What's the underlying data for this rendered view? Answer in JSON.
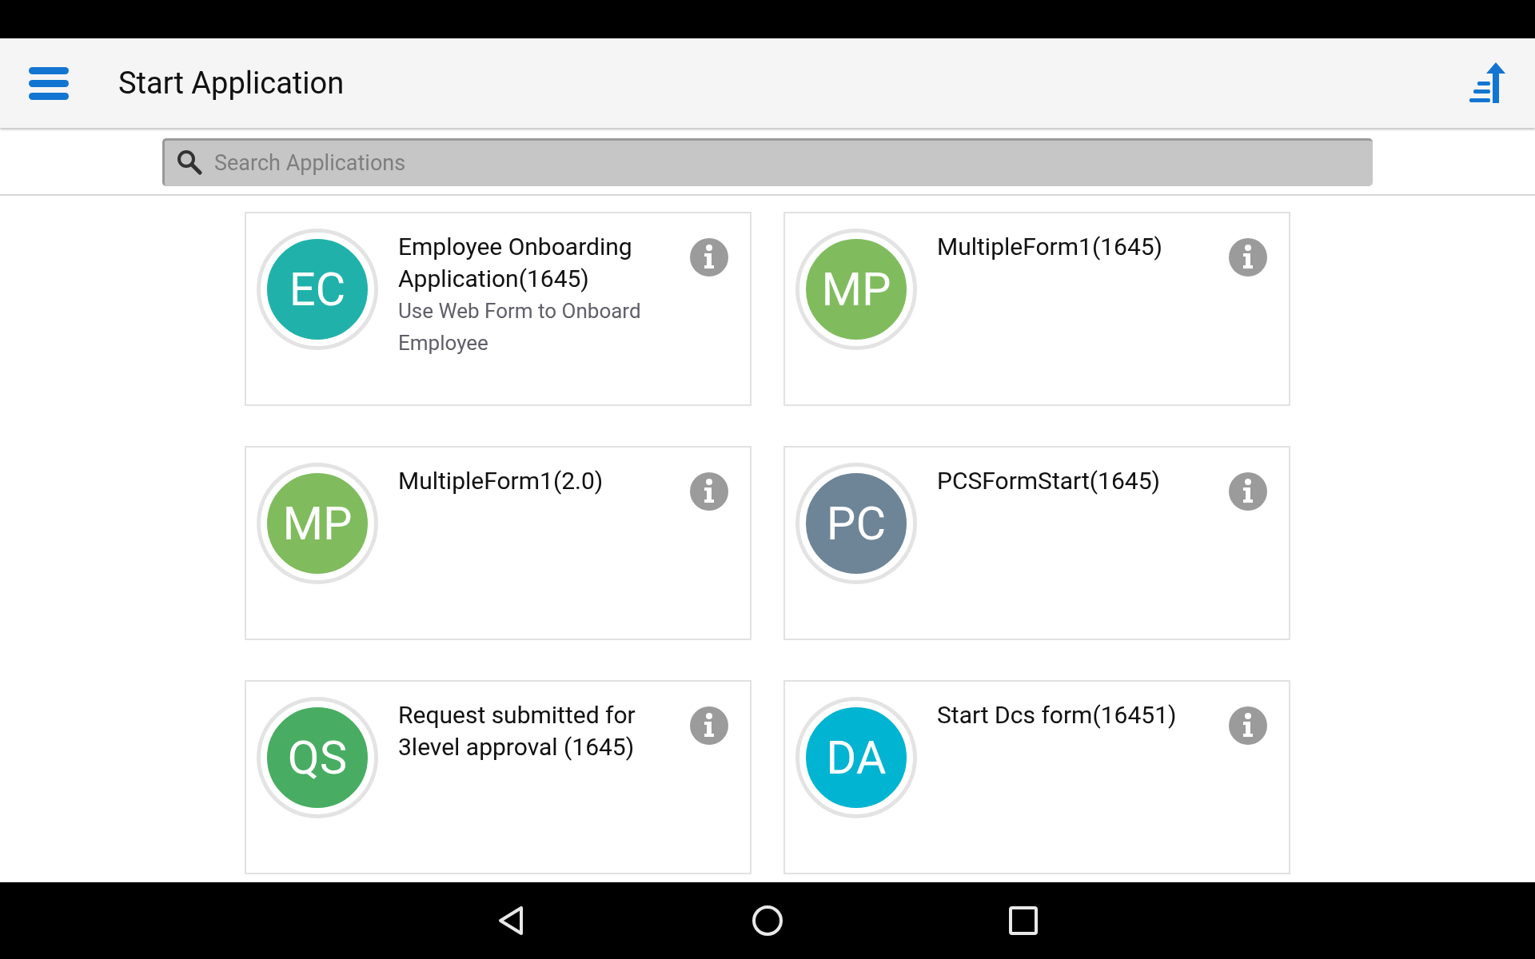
{
  "header": {
    "title": "Start Application"
  },
  "search": {
    "placeholder": "Search Applications"
  },
  "applications": [
    {
      "initials": "EC",
      "color": "#20b2aa",
      "title": "Employee Onboarding Application(1645)",
      "description": "Use Web Form to Onboard Employee"
    },
    {
      "initials": "MP",
      "color": "#80bc5e",
      "title": "MultipleForm1(1645)"
    },
    {
      "initials": "MP",
      "color": "#80bc5e",
      "title": "MultipleForm1(2.0)"
    },
    {
      "initials": "PC",
      "color": "#6e8598",
      "title": "PCSFormStart(1645)"
    },
    {
      "initials": "QS",
      "color": "#48ad62",
      "title": "Request submitted for 3level approval (1645)"
    },
    {
      "initials": "DA",
      "color": "#00b4d2",
      "title": "Start Dcs form(16451)"
    }
  ]
}
